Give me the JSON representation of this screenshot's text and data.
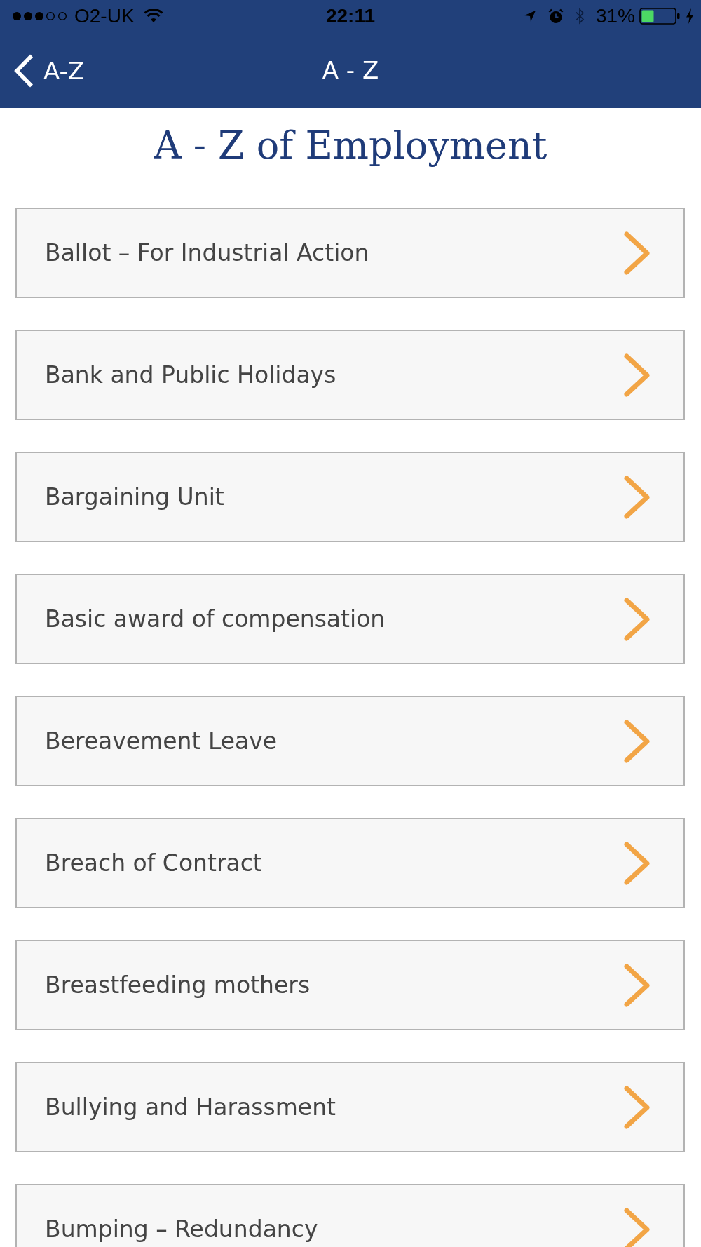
{
  "status_bar": {
    "carrier": "O2-UK",
    "time": "22:11",
    "battery": "31%"
  },
  "nav_bar": {
    "back_label": "A-Z",
    "title": "A - Z"
  },
  "heading": "A - Z of Employment",
  "topics": [
    "Ballot – For Industrial Action",
    "Bank and Public Holidays",
    "Bargaining Unit",
    "Basic award of compensation",
    "Bereavement Leave",
    "Breach of Contract",
    "Breastfeeding mothers",
    "Bullying and Harassment",
    "Bumping – Redundancy"
  ]
}
